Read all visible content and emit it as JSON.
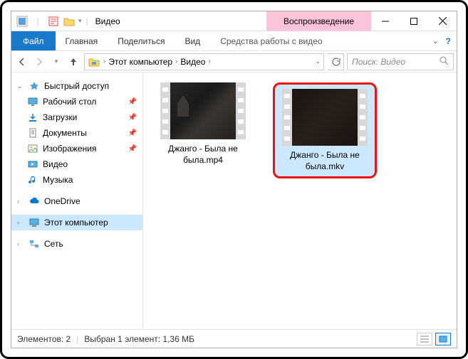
{
  "title": "Видео",
  "title_tab": "Воспроизведение",
  "ribbon": {
    "file": "Файл",
    "tabs": [
      "Главная",
      "Поделиться",
      "Вид"
    ],
    "tools_tab": "Средства работы с видео"
  },
  "breadcrumb": {
    "items": [
      "Этот компьютер",
      "Видео"
    ]
  },
  "search": {
    "placeholder": "Поиск: Видео"
  },
  "sidebar": {
    "quick": {
      "label": "Быстрый доступ",
      "items": [
        {
          "label": "Рабочий стол",
          "icon": "desktop"
        },
        {
          "label": "Загрузки",
          "icon": "downloads"
        },
        {
          "label": "Документы",
          "icon": "documents"
        },
        {
          "label": "Изображения",
          "icon": "pictures"
        },
        {
          "label": "Видео",
          "icon": "video"
        },
        {
          "label": "Музыка",
          "icon": "music"
        }
      ]
    },
    "onedrive": "OneDrive",
    "thispc": "Этот компьютер",
    "network": "Сеть"
  },
  "files": [
    {
      "name": "Джанго - Была не была.mp4"
    },
    {
      "name": "Джанго - Была не была.mkv"
    }
  ],
  "status": {
    "count_label": "Элементов: 2",
    "selection_label": "Выбран 1 элемент: 1,36 МБ"
  }
}
